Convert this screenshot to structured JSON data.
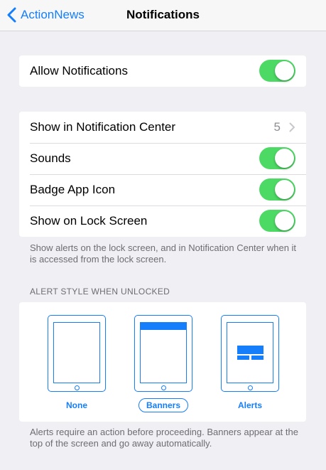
{
  "navbar": {
    "back_label": "ActionNews",
    "title": "Notifications"
  },
  "allow": {
    "label": "Allow Notifications",
    "enabled": true
  },
  "settings": {
    "notification_center": {
      "label": "Show in Notification Center",
      "value": "5"
    },
    "sounds": {
      "label": "Sounds",
      "enabled": true
    },
    "badge": {
      "label": "Badge App Icon",
      "enabled": true
    },
    "lock_screen": {
      "label": "Show on Lock Screen",
      "enabled": true
    },
    "footer": "Show alerts on the lock screen, and in Notification Center when it is accessed from the lock screen."
  },
  "alert_style": {
    "header": "ALERT STYLE WHEN UNLOCKED",
    "options": [
      {
        "label": "None",
        "selected": false
      },
      {
        "label": "Banners",
        "selected": true
      },
      {
        "label": "Alerts",
        "selected": false
      }
    ],
    "footer": "Alerts require an action before proceeding. Banners appear at the top of the screen and go away automatically."
  },
  "colors": {
    "accent": "#157efb",
    "toggle_on": "#4cd964",
    "background": "#efeff4"
  }
}
